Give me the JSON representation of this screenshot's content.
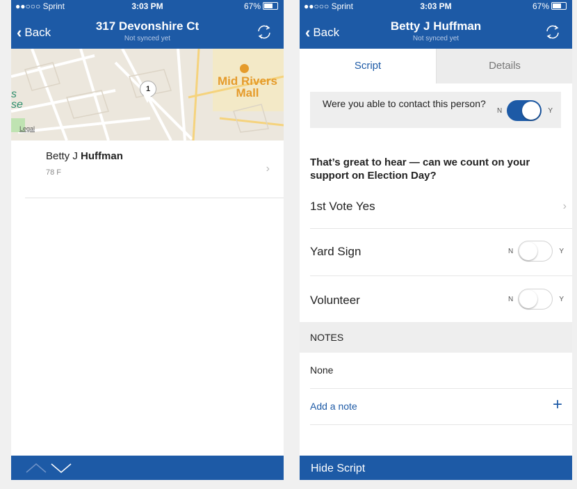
{
  "colors": {
    "brand_blue": "#1d5aa6",
    "mall_orange": "#e59b2b"
  },
  "left": {
    "status": {
      "carrier": "●●○○○ Sprint",
      "time": "3:03 PM",
      "battery": "67%"
    },
    "nav": {
      "back_label": "Back",
      "title": "317 Devonshire Ct",
      "subtitle": "Not synced yet"
    },
    "map": {
      "place_label": "Mid Rivers Mall",
      "pin_number": "1",
      "edge_text": "s\nse",
      "legal": "Legal"
    },
    "person": {
      "first": "Betty J",
      "last": "Huffman",
      "meta": "78 F"
    },
    "icons": {
      "back": "chevron-left-icon",
      "sync": "sync-icon",
      "up": "chevron-up-icon",
      "down": "chevron-down-icon"
    }
  },
  "right": {
    "status": {
      "carrier": "●●○○○ Sprint",
      "time": "3:03 PM",
      "battery": "67%"
    },
    "nav": {
      "back_label": "Back",
      "title": "Betty J Huffman",
      "subtitle": "Not synced yet"
    },
    "tabs": [
      {
        "label": "Script",
        "selected": true
      },
      {
        "label": "Details",
        "selected": false
      }
    ],
    "contact": {
      "question": "Were you able to contact this person?",
      "n": "N",
      "y": "Y",
      "value": true
    },
    "question": "That’s great to hear — can we count on your support on Election Day?",
    "vote": {
      "label": "1st Vote Yes"
    },
    "yard_sign": {
      "label": "Yard Sign",
      "n": "N",
      "y": "Y",
      "value": false
    },
    "volunteer": {
      "label": "Volunteer",
      "n": "N",
      "y": "Y",
      "value": false
    },
    "notes": {
      "header": "NOTES",
      "value": "None",
      "add_label": "Add a note",
      "add_icon": "+"
    },
    "bottom": {
      "hide_script": "Hide Script"
    }
  }
}
